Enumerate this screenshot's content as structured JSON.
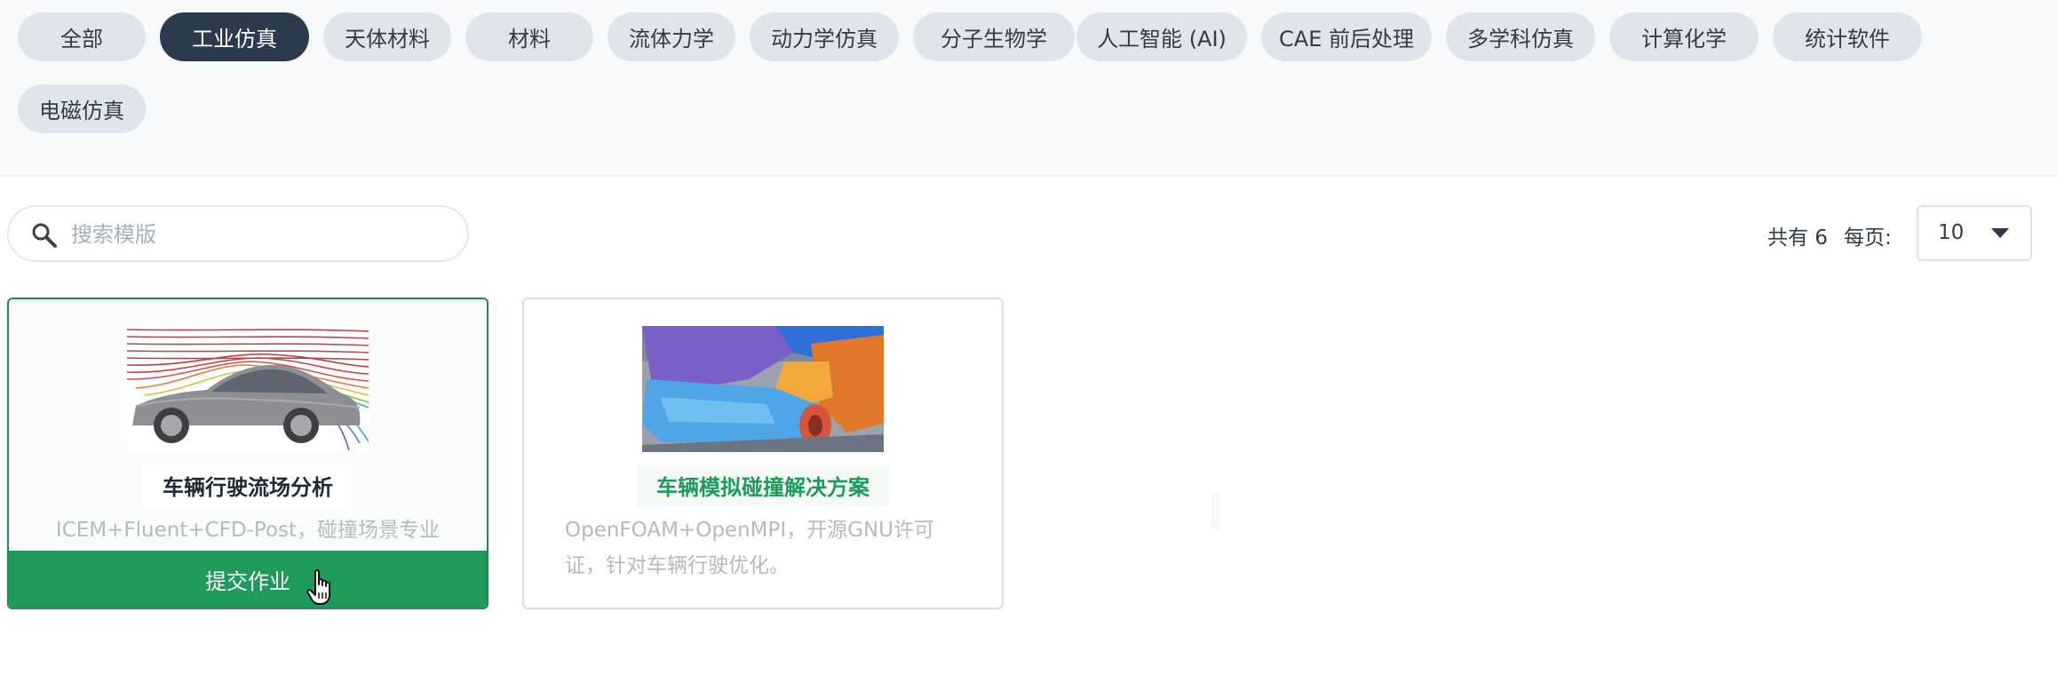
{
  "categories": [
    {
      "label": "全部",
      "active": false
    },
    {
      "label": "工业仿真",
      "active": true
    },
    {
      "label": "天体材料",
      "active": false
    },
    {
      "label": "材料",
      "active": false
    },
    {
      "label": "流体力学",
      "active": false
    },
    {
      "label": "动力学仿真",
      "active": false
    },
    {
      "label": "分子生物学",
      "active": false
    },
    {
      "label": "人工智能 (AI)",
      "active": false
    },
    {
      "label": "CAE 前后处理",
      "active": false
    },
    {
      "label": "多学科仿真",
      "active": false
    },
    {
      "label": "计算化学",
      "active": false
    },
    {
      "label": "统计软件",
      "active": false
    },
    {
      "label": "电磁仿真",
      "active": false
    }
  ],
  "search": {
    "placeholder": "搜索模版",
    "value": ""
  },
  "pagination": {
    "total_text": "共有 6",
    "per_page_label": "每页:",
    "per_page_value": "10"
  },
  "cards": [
    {
      "title": "车辆行驶流场分析",
      "description": "ICEM+Fluent+CFD-Post，碰撞场景专业",
      "action_label": "提交作业",
      "image": "car-flow-streamlines-image"
    },
    {
      "title": "车辆模拟碰撞解决方案",
      "description": "OpenFOAM+OpenMPI，开源GNU许可证，针对车辆行驶优化。",
      "image": "car-crash-simulation-image"
    }
  ],
  "colors": {
    "accent": "#1f9a5b",
    "active_chip": "#2b3a4c",
    "chip": "#dfe5ea"
  }
}
